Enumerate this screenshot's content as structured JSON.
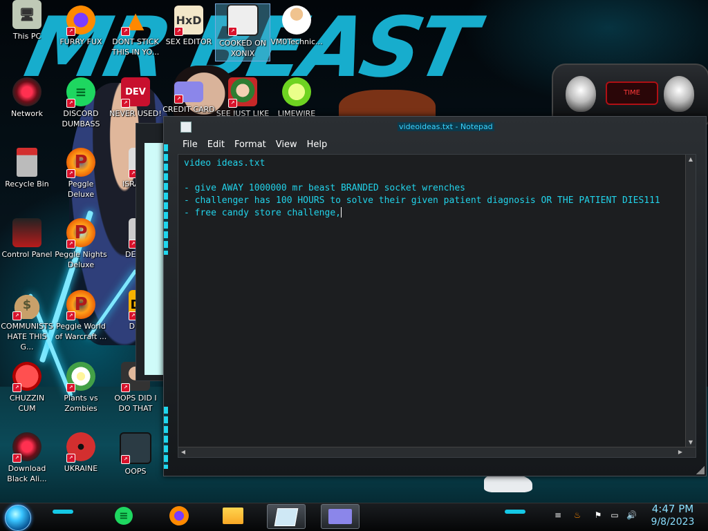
{
  "desktop": {
    "icons": [
      {
        "label": "This PC"
      },
      {
        "label": "FURRY FUX"
      },
      {
        "label": "DONT STICK THIS IN YO..."
      },
      {
        "label": "SEX EDITOR"
      },
      {
        "label": "COOKED ON XONIX"
      },
      {
        "label": "VM0Technic..."
      },
      {
        "label": "Network"
      },
      {
        "label": "DISCORD DUMBASS"
      },
      {
        "label": "NEVER USED!"
      },
      {
        "label": "CREDIT CARD"
      },
      {
        "label": "SEE JUST LIKE"
      },
      {
        "label": "LIMEWIRE"
      },
      {
        "label": "Recycle Bin"
      },
      {
        "label": "Peggle Deluxe"
      },
      {
        "label": "ISRAEL"
      },
      {
        "label": "Control Panel"
      },
      {
        "label": "Peggle Nights Deluxe"
      },
      {
        "label": "DEEZ"
      },
      {
        "label": "COMMUNISTS HATE THIS G..."
      },
      {
        "label": "Peggle World of Warcraft ..."
      },
      {
        "label": "DIE"
      },
      {
        "label": "CHUZZIN CUM"
      },
      {
        "label": "Plants vs Zombies"
      },
      {
        "label": "OOPS DID I DO THAT"
      },
      {
        "label": "Download Black Ali..."
      },
      {
        "label": "UKRAINE"
      },
      {
        "label": "OOPS"
      }
    ]
  },
  "wallpaper": {
    "banner_text": "MR BEAST"
  },
  "widget": {
    "center_label": "TIME"
  },
  "notepad": {
    "title": "videoideas.txt - Notepad",
    "menu": [
      "File",
      "Edit",
      "Format",
      "View",
      "Help"
    ],
    "content": "video ideas.txt\n\n- give AWAY 1000000 mr beast BRANDED socket wrenches\n- challenger has 100 HOURS to solve their given patient diagnosis OR THE PATIENT DIES111\n- free candy store challenge,"
  },
  "taskbar": {
    "clock": {
      "time": "4:47 PM",
      "date": "9/8/2023"
    }
  },
  "colors": {
    "accent_cyan": "#19b6d8",
    "text_cyan": "#22d3ea",
    "clock": "#8adfff"
  }
}
